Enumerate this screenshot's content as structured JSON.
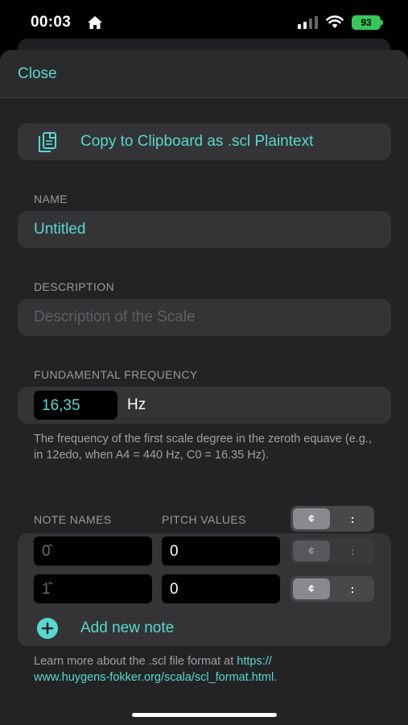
{
  "status_bar": {
    "time": "00:03",
    "battery": "93",
    "icons": [
      "home-icon",
      "signal-icon",
      "wifi-icon",
      "battery-icon"
    ]
  },
  "header": {
    "close_label": "Close"
  },
  "copy_button": {
    "label": "Copy to Clipboard as .scl Plaintext",
    "icon": "copy-icon"
  },
  "name_section": {
    "label": "NAME",
    "value": "Untitled"
  },
  "description_section": {
    "label": "DESCRIPTION",
    "placeholder": "Description of the Scale"
  },
  "frequency_section": {
    "label": "FUNDAMENTAL FREQUENCY",
    "value": "16,35",
    "unit": "Hz",
    "helper": "The frequency of the first scale degree in the zeroth equave (e.g., in 12edo, when A4 = 440 Hz, C0 = 16.35 Hz)."
  },
  "notes_section": {
    "names_header": "NOTE NAMES",
    "pitch_header": "PITCH VALUES",
    "mode_cents": "¢",
    "mode_ratio": ":",
    "rows": [
      {
        "name_placeholder": "0̂",
        "pitch": "0"
      },
      {
        "name_placeholder": "1̂",
        "pitch": "0"
      }
    ],
    "add_label": "Add new note"
  },
  "footer": {
    "text": "Learn more about the .scl file format at ",
    "link": "https://www.huygens-fokker.org/scala/scl_format.html",
    "link_line1": "https://",
    "link_line2": "www.huygens-fokker.org/scala/scl_format.html",
    "suffix": "."
  },
  "colors": {
    "accent": "#58d8cf",
    "background": "#232325",
    "card": "#343436",
    "battery": "#35c759"
  }
}
